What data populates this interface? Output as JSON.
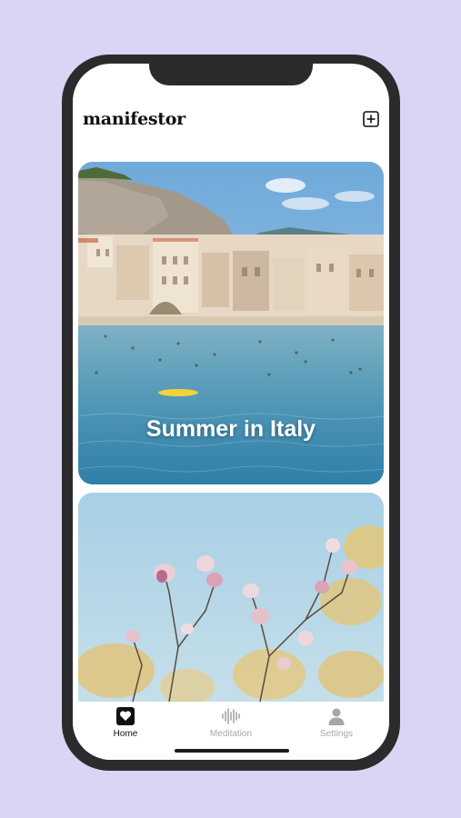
{
  "app": {
    "logo_text": "manifestor"
  },
  "header": {
    "add_icon": "plus-square-icon"
  },
  "cards": [
    {
      "title": "Summer in Italy",
      "image": "coastal-town-beach-photo"
    },
    {
      "title": "",
      "image": "magnolia-blossoms-photo"
    }
  ],
  "tabbar": {
    "items": [
      {
        "label": "Home",
        "icon": "heart-square-icon",
        "active": true
      },
      {
        "label": "Meditation",
        "icon": "sound-wave-icon",
        "active": false
      },
      {
        "label": "Settings",
        "icon": "person-icon",
        "active": false
      }
    ]
  },
  "colors": {
    "background": "#d8d5f5",
    "phone_frame": "#2b2b2d",
    "active_tab": "#111111",
    "inactive_tab": "#a6a6a6"
  }
}
